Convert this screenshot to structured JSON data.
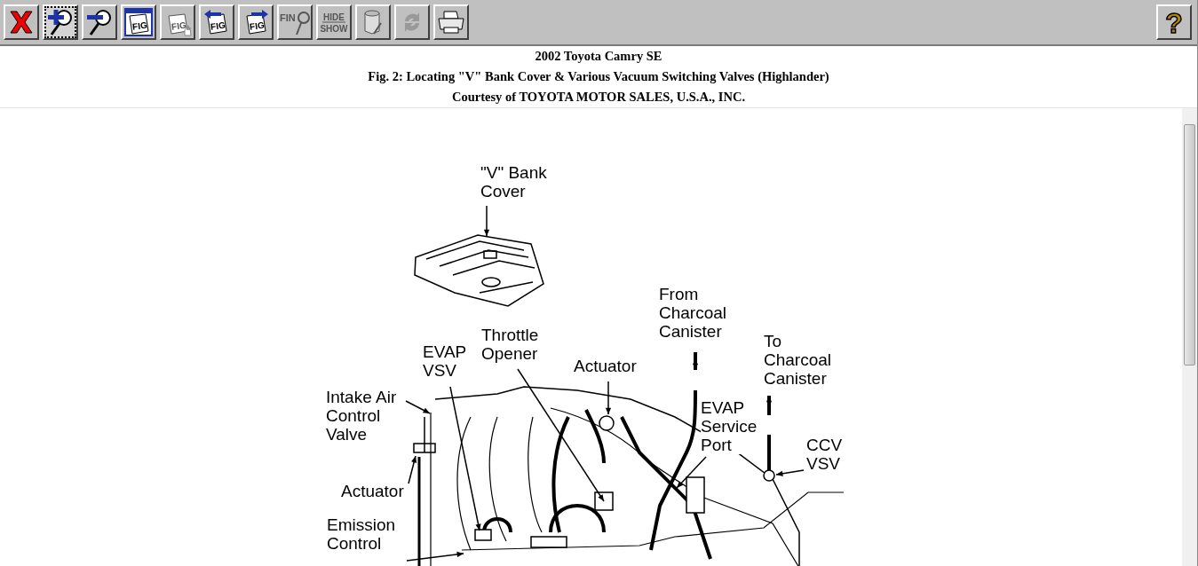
{
  "toolbar": {
    "buttons": [
      {
        "kind": "close",
        "selected": false,
        "disabled": false
      },
      {
        "kind": "zoom-in",
        "selected": true,
        "disabled": false
      },
      {
        "kind": "zoom-out",
        "selected": false,
        "disabled": false
      },
      {
        "kind": "fig-window",
        "label": "FIG",
        "selected": false,
        "disabled": false
      },
      {
        "kind": "fig-hand",
        "label": "FIG",
        "selected": false,
        "disabled": true
      },
      {
        "kind": "fig-prev",
        "label": "FIG",
        "selected": false,
        "disabled": false
      },
      {
        "kind": "fig-next",
        "label": "FIG",
        "selected": false,
        "disabled": false
      },
      {
        "kind": "find",
        "label": "FIN",
        "selected": false,
        "disabled": true
      },
      {
        "kind": "hide-show",
        "label": "HIDE",
        "label2": "SHOW",
        "selected": false,
        "disabled": true
      },
      {
        "kind": "can",
        "selected": false,
        "disabled": true
      },
      {
        "kind": "refresh",
        "selected": false,
        "disabled": true
      },
      {
        "kind": "print",
        "selected": false,
        "disabled": false
      }
    ],
    "help": {
      "label": "?"
    }
  },
  "header": {
    "title": "2002 Toyota Camry SE",
    "caption": "Fig. 2: Locating \"V\" Bank Cover & Various Vacuum Switching Valves (Highlander)",
    "credit": "Courtesy of TOYOTA MOTOR SALES, U.S.A., INC."
  },
  "figure": {
    "labels": [
      {
        "text": "\"V\" Bank\nCover"
      },
      {
        "text": "From\nCharcoal\nCanister"
      },
      {
        "text": "EVAP\nVSV"
      },
      {
        "text": "Throttle\nOpener"
      },
      {
        "text": "Actuator"
      },
      {
        "text": "To\nCharcoal\nCanister"
      },
      {
        "text": "Intake Air\nControl\nValve"
      },
      {
        "text": "EVAP\nService\nPort"
      },
      {
        "text": "CCV\nVSV"
      },
      {
        "text": "Actuator"
      },
      {
        "text": "Emission\nControl"
      }
    ]
  }
}
